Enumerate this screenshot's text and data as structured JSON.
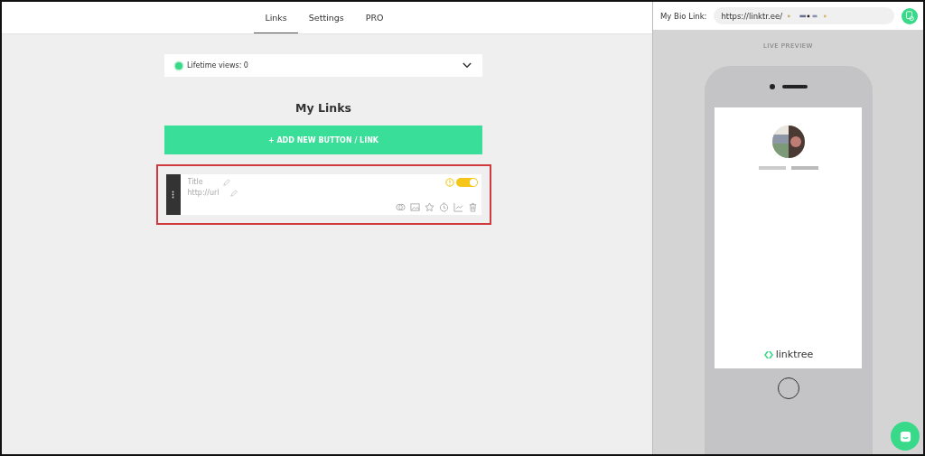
{
  "tabs": [
    {
      "label": "Links",
      "selected": true
    },
    {
      "label": "Settings",
      "selected": false
    },
    {
      "label": "PRO",
      "selected": false
    }
  ],
  "bio_link": {
    "label": "My Bio Link:",
    "url": "https://linktr.ee/"
  },
  "views": {
    "text": "Lifetime views: 0"
  },
  "heading": "My Links",
  "add_button": "+ ADD NEW BUTTON / LINK",
  "links": [
    {
      "title_placeholder": "Title",
      "url_placeholder": "http://url",
      "enabled": true,
      "highlighted": true
    }
  ],
  "preview": {
    "label": "LIVE PREVIEW",
    "brand": "linktree"
  }
}
